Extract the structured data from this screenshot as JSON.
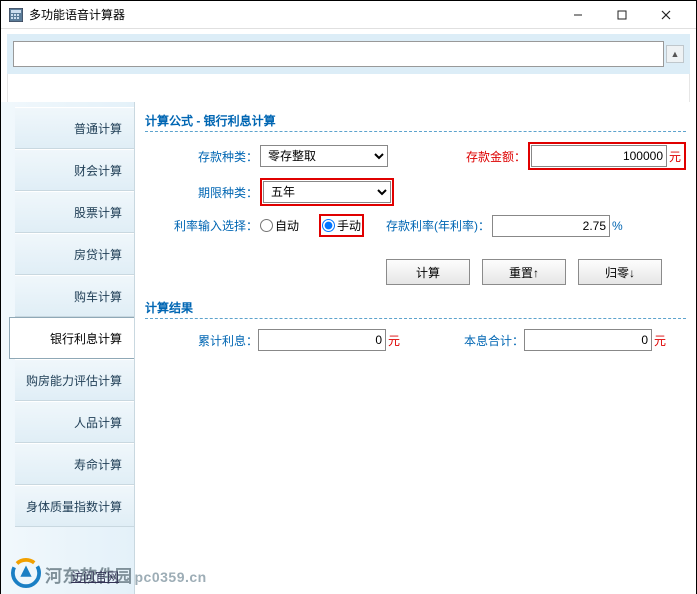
{
  "window": {
    "title": "多功能语音计算器"
  },
  "sidebar": {
    "tabs": [
      {
        "label": "普通计算"
      },
      {
        "label": "财会计算"
      },
      {
        "label": "股票计算"
      },
      {
        "label": "房贷计算"
      },
      {
        "label": "购车计算"
      },
      {
        "label": "银行利息计算"
      },
      {
        "label": "购房能力评估计算"
      },
      {
        "label": "人品计算"
      },
      {
        "label": "寿命计算"
      },
      {
        "label": "身体质量指数计算"
      }
    ],
    "active_index": 5
  },
  "formula": {
    "title": "计算公式 - 银行利息计算",
    "deposit_type": {
      "label": "存款种类：",
      "value": "零存整取"
    },
    "deposit_amount": {
      "label": "存款金额：",
      "value": "100000",
      "unit": "元"
    },
    "term": {
      "label": "期限种类：",
      "value": "五年"
    },
    "rate_mode": {
      "label": "利率输入选择：",
      "auto": {
        "label": "自动",
        "checked": false
      },
      "manual": {
        "label": "手动",
        "checked": true
      }
    },
    "rate": {
      "label": "存款利率(年利率)：",
      "value": "2.75",
      "unit": "%"
    },
    "buttons": {
      "calc": "计算",
      "reset": "重置↑",
      "zero": "归零↓"
    }
  },
  "result": {
    "title": "计算结果",
    "interest": {
      "label": "累计利息：",
      "value": "0",
      "unit": "元"
    },
    "total": {
      "label": "本息合计：",
      "value": "0",
      "unit": "元"
    }
  },
  "footer": {
    "brand": "河东软件园",
    "domain": "pc0359.cn",
    "visit": "访问官网"
  }
}
